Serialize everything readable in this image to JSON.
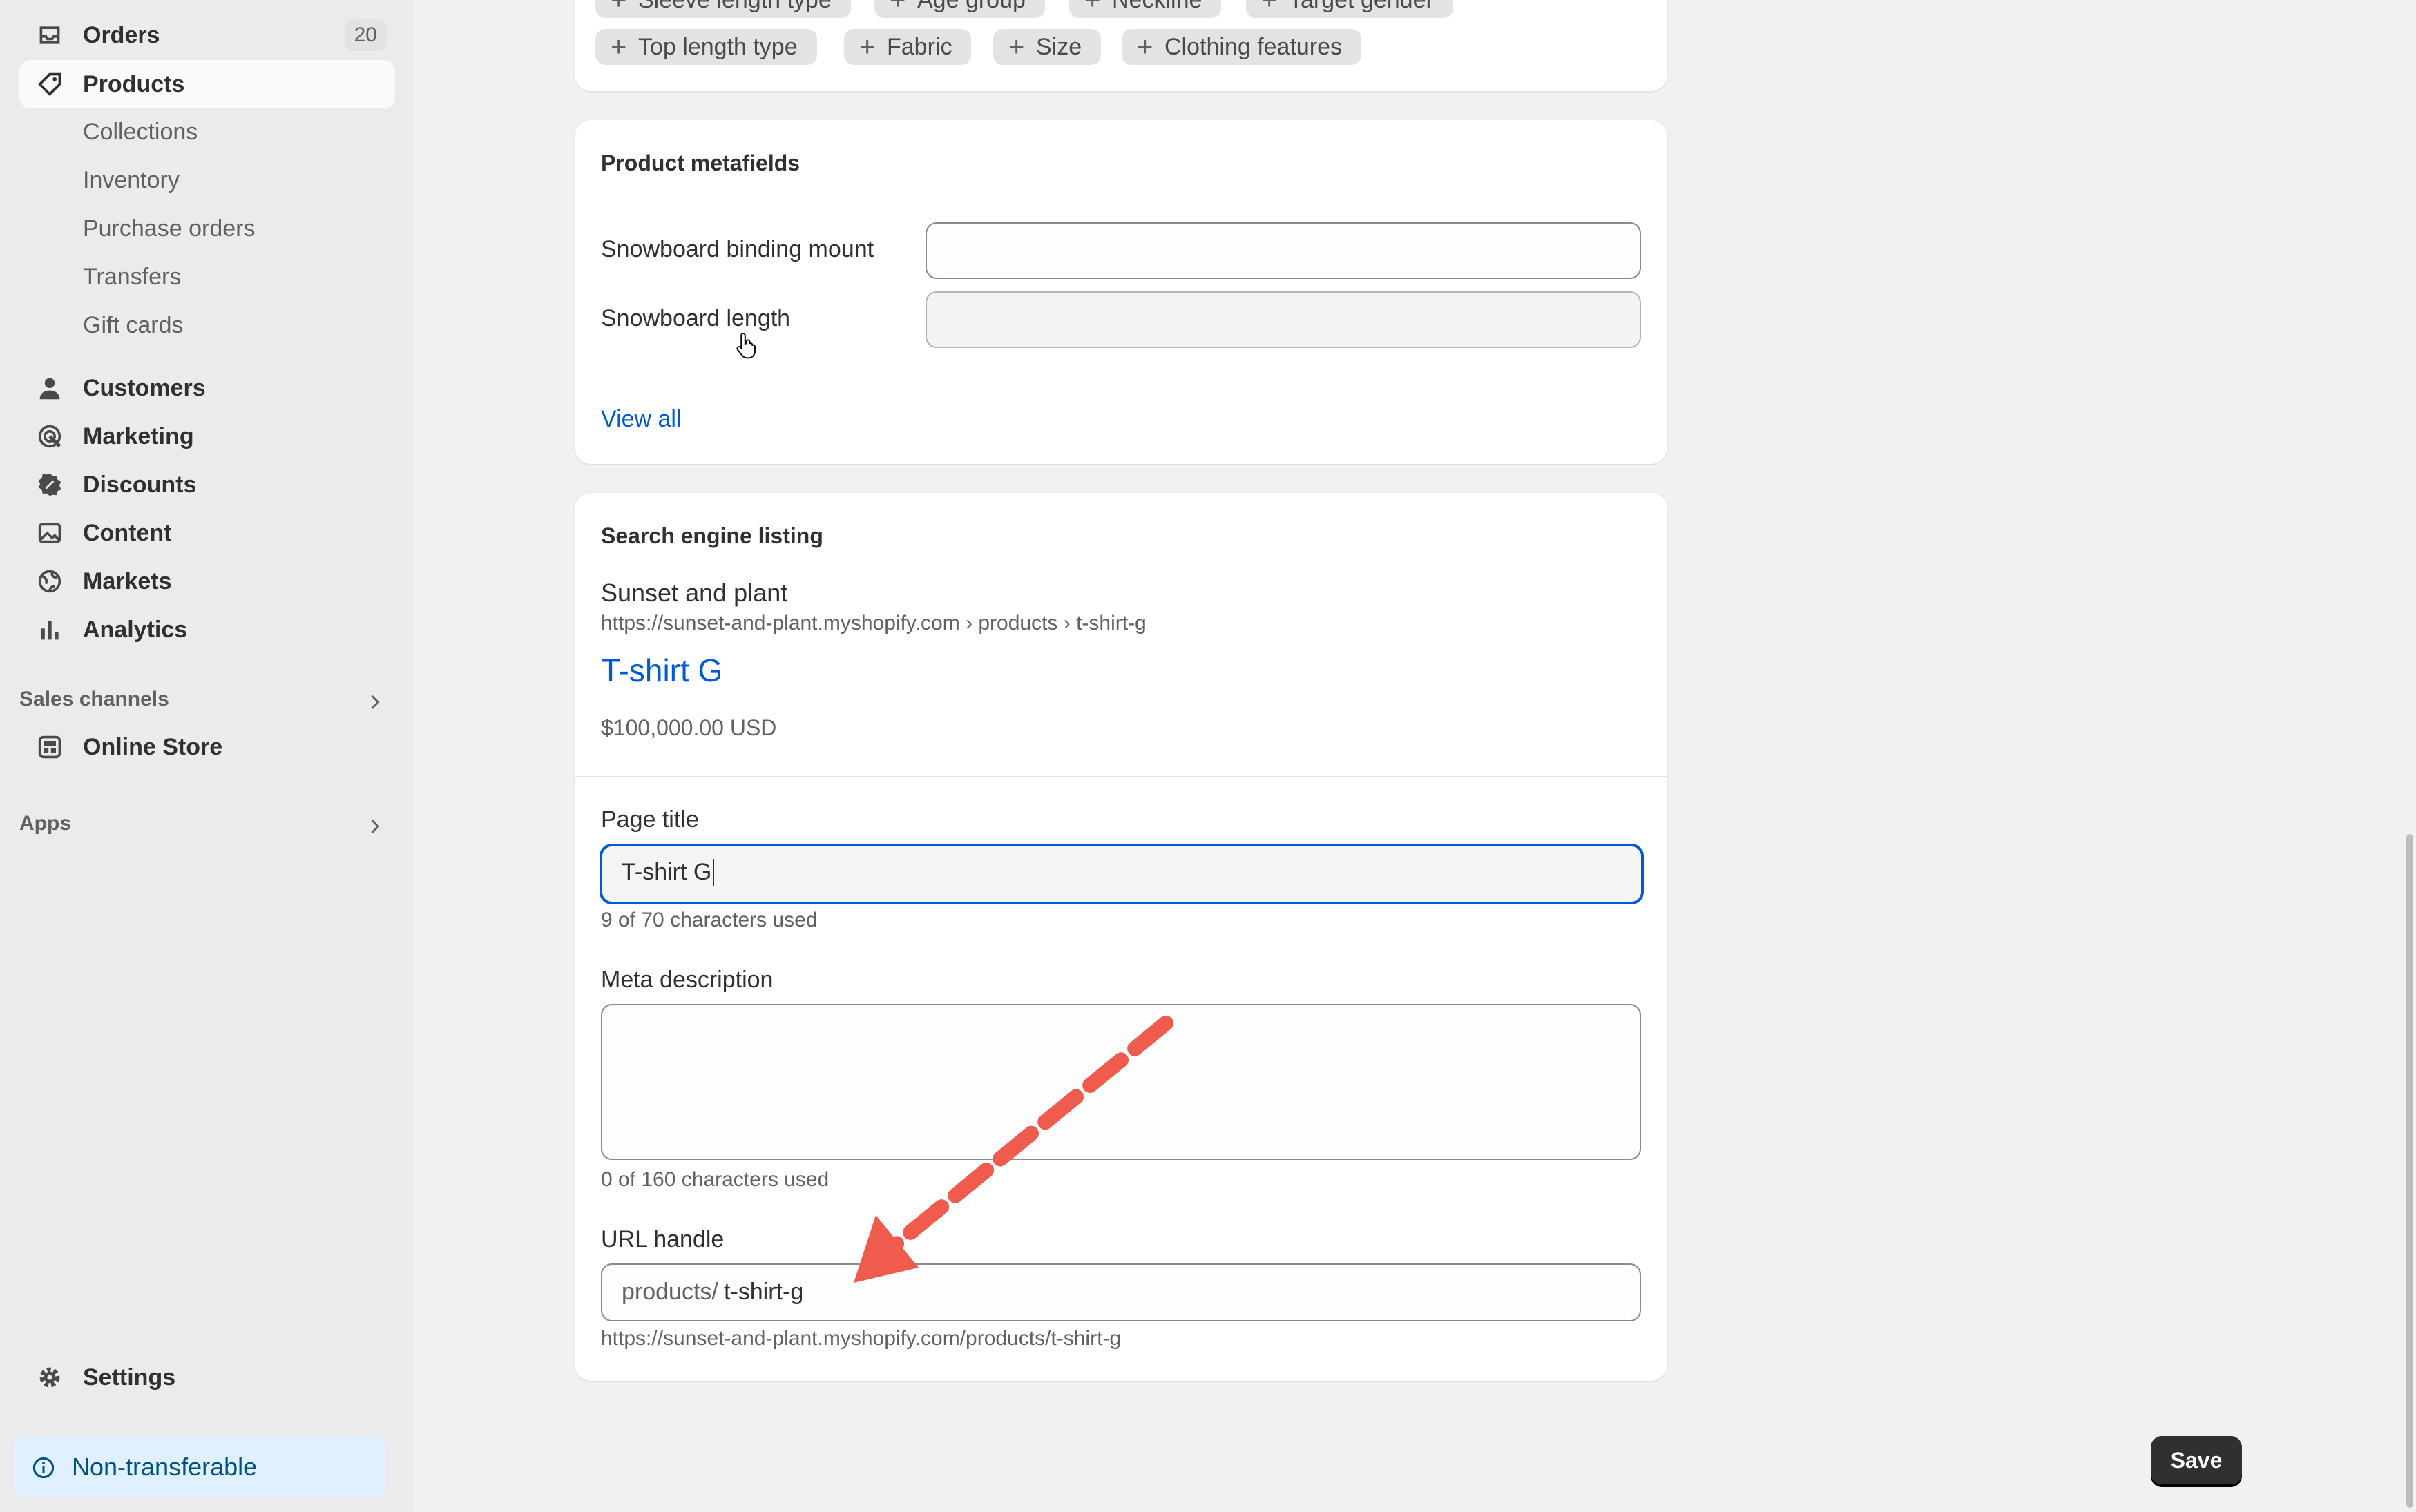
{
  "sidebar": {
    "orders": {
      "label": "Orders",
      "count": "20"
    },
    "products": {
      "label": "Products"
    },
    "product_subitems": [
      "Collections",
      "Inventory",
      "Purchase orders",
      "Transfers",
      "Gift cards"
    ],
    "customers": "Customers",
    "marketing": "Marketing",
    "discounts": "Discounts",
    "content": "Content",
    "markets": "Markets",
    "analytics": "Analytics",
    "sales_channels": "Sales channels",
    "online_store": "Online Store",
    "apps": "Apps",
    "settings": "Settings",
    "notice": "Non-transferable"
  },
  "category_chips": {
    "top_row": [
      "Sleeve length type",
      "Age group",
      "Neckline",
      "Target gender"
    ],
    "bottom_row": [
      "Top length type",
      "Fabric",
      "Size",
      "Clothing features"
    ]
  },
  "metafields": {
    "title": "Product metafields",
    "binding_mount": {
      "label": "Snowboard binding mount",
      "value": ""
    },
    "length": {
      "label": "Snowboard length",
      "value": ""
    },
    "view_all": "View all"
  },
  "seo": {
    "title": "Search engine listing",
    "store_name": "Sunset and plant",
    "breadcrumb_url": "https://sunset-and-plant.myshopify.com › products › t-shirt-g",
    "preview_title": "T-shirt G",
    "price": "$100,000.00 USD",
    "page_title_label": "Page title",
    "page_title_value": "T-shirt G",
    "page_title_help": "9 of 70 characters used",
    "meta_label": "Meta description",
    "meta_value": "",
    "meta_help": "0 of 160 characters used",
    "url_label": "URL handle",
    "url_prefix": "products/",
    "url_value": "t-shirt-g",
    "url_full": "https://sunset-and-plant.myshopify.com/products/t-shirt-g"
  },
  "actions": {
    "save": "Save"
  },
  "colors": {
    "accent_link": "#005bd3",
    "focus_ring": "#005bd3",
    "annotation_arrow": "#ef5b4c"
  }
}
